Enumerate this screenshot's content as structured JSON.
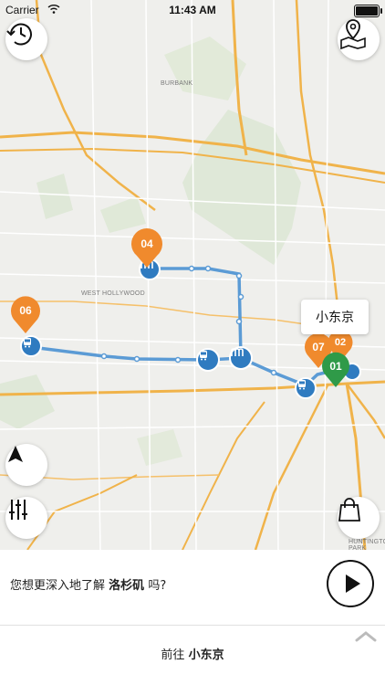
{
  "status_bar": {
    "carrier": "Carrier",
    "time": "11:43 AM"
  },
  "map": {
    "labels": [
      "BURBANK",
      "WEST HOLLYWOOD",
      "HUNTINGTON PARK"
    ],
    "markers": [
      {
        "number": "04",
        "color": "#f08a2d"
      },
      {
        "number": "06",
        "color": "#f08a2d"
      },
      {
        "number": "07",
        "color": "#f08a2d"
      },
      {
        "number": "02",
        "color": "#f08a2d"
      },
      {
        "number": "01",
        "color": "#2f9a48"
      }
    ],
    "route_color": "#5b9bd5",
    "callout_text": "小东京"
  },
  "bottom": {
    "question_prefix": "您想更深入地了解",
    "question_place": "洛杉矶",
    "question_suffix": "吗?",
    "goto_prefix": "前往",
    "goto_place": "小东京"
  }
}
